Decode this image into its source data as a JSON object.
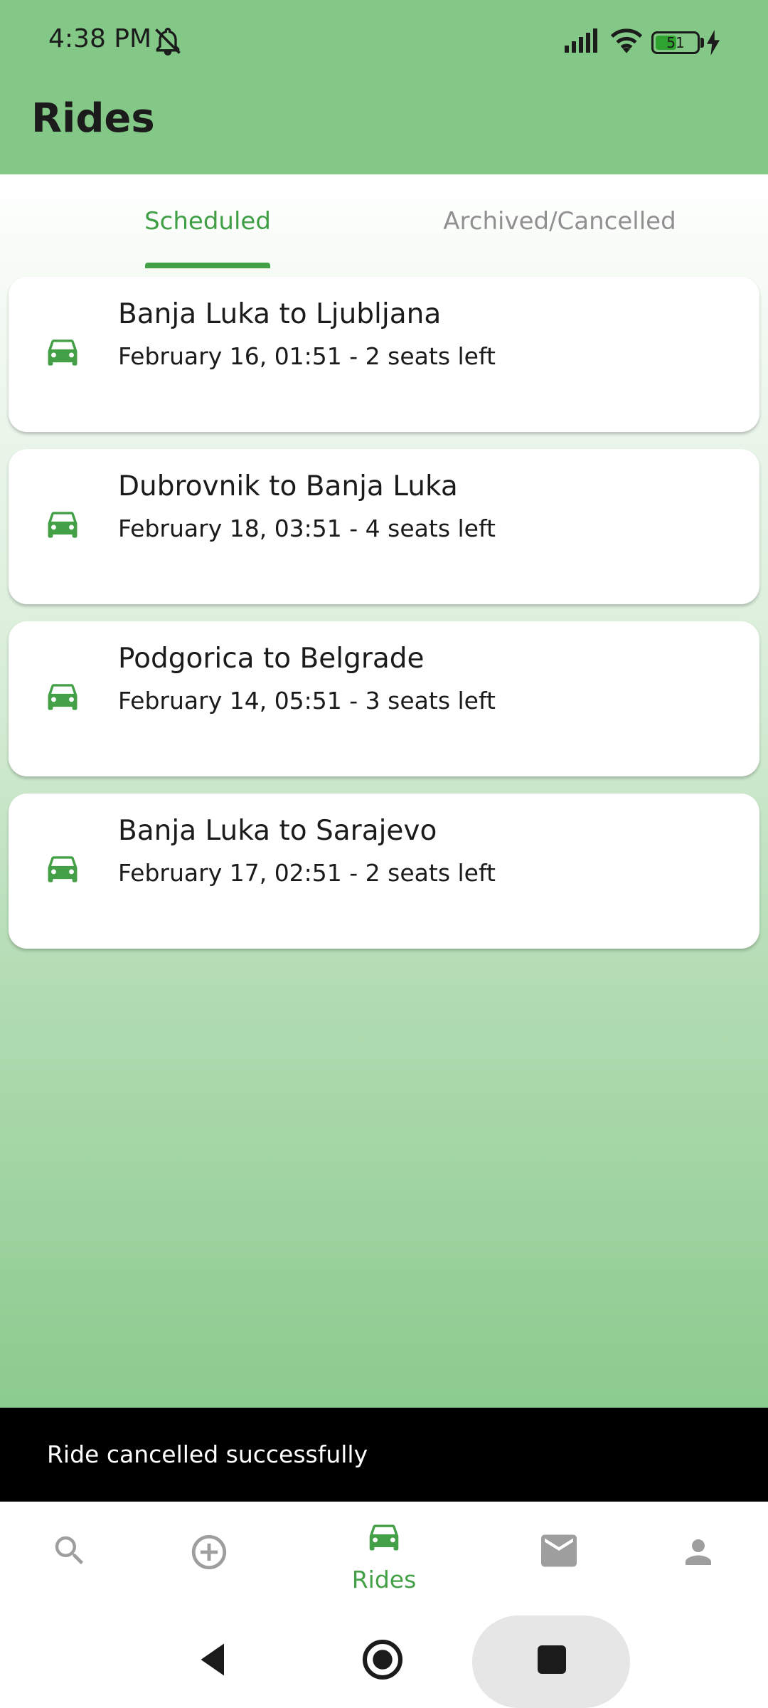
{
  "status_bar": {
    "time": "4:38 PM",
    "battery_level": "51",
    "battery_fraction": 0.51,
    "icons": [
      "mute-icon",
      "signal-icon",
      "wifi-icon",
      "battery-icon",
      "charging-icon"
    ]
  },
  "header": {
    "title": "Rides"
  },
  "tabs": [
    {
      "label": "Scheduled",
      "active": true
    },
    {
      "label": "Archived/Cancelled",
      "active": false
    }
  ],
  "rides": [
    {
      "route": "Banja Luka to Ljubljana",
      "details": "February 16, 01:51 - 2 seats left",
      "icon": "car-icon"
    },
    {
      "route": "Dubrovnik to Banja Luka",
      "details": "February 18, 03:51 - 4 seats left",
      "icon": "car-icon"
    },
    {
      "route": "Podgorica to Belgrade",
      "details": "February 14, 05:51 - 3 seats left",
      "icon": "car-icon"
    },
    {
      "route": "Banja Luka to Sarajevo",
      "details": "February 17, 02:51 - 2 seats left",
      "icon": "car-icon"
    }
  ],
  "snackbar": {
    "message": "Ride cancelled successfully"
  },
  "bottom_nav": {
    "items": [
      {
        "icon": "search-icon",
        "label": ""
      },
      {
        "icon": "add-circle-icon",
        "label": ""
      },
      {
        "icon": "car-icon",
        "label": "Rides",
        "active": true
      },
      {
        "icon": "mail-icon",
        "label": ""
      },
      {
        "icon": "person-icon",
        "label": ""
      }
    ]
  },
  "colors": {
    "header_bg": "#84c887",
    "accent": "#43a047",
    "inactive_icon": "#9e9e9e",
    "snackbar_bg": "#000000"
  }
}
